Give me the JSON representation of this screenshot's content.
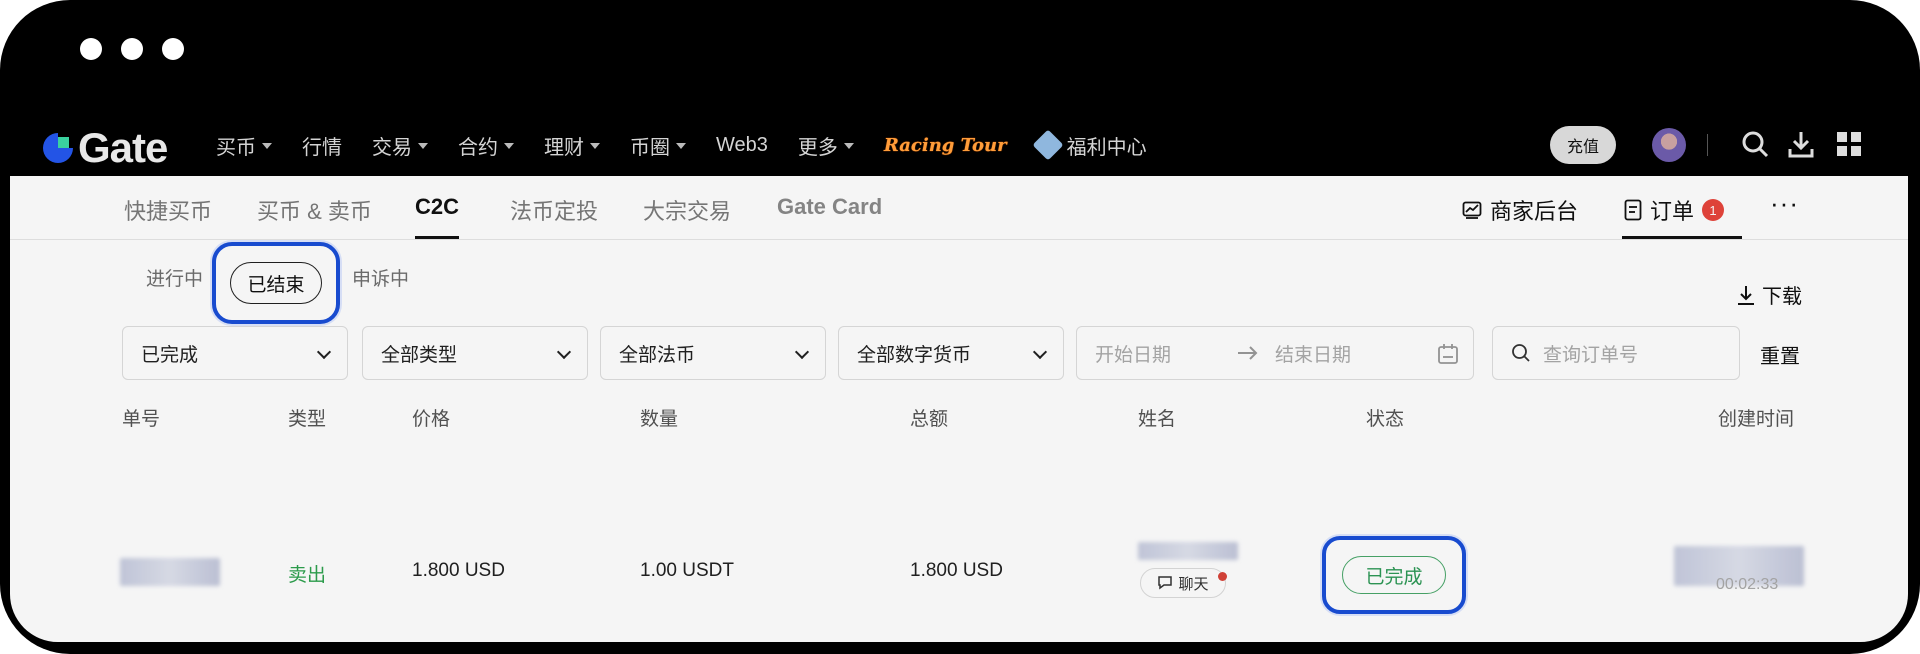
{
  "colors": {
    "accent": "#1a4fd8",
    "success": "#2e9a57",
    "badge": "#e8453c"
  },
  "brand": {
    "name": "Gate"
  },
  "topnav": {
    "items": [
      {
        "label": "买币",
        "dropdown": true
      },
      {
        "label": "行情",
        "dropdown": false
      },
      {
        "label": "交易",
        "dropdown": true
      },
      {
        "label": "合约",
        "dropdown": true
      },
      {
        "label": "理财",
        "dropdown": true
      },
      {
        "label": "币圈",
        "dropdown": true
      },
      {
        "label": "Web3",
        "dropdown": false
      },
      {
        "label": "更多",
        "dropdown": true
      }
    ],
    "racing_label": "Racing Tour",
    "welfare_label": "福利中心",
    "recharge_label": "充值"
  },
  "subnav": {
    "tabs": [
      "快捷买币",
      "买币 & 卖币",
      "C2C",
      "法币定投",
      "大宗交易",
      "Gate Card"
    ],
    "merchant_label": "商家后台",
    "orders_label": "订单",
    "orders_badge": "1",
    "more_label": "···"
  },
  "status_tabs": {
    "ongoing": "进行中",
    "ended": "已结束",
    "appeal": "申诉中"
  },
  "download_label": "下载",
  "filters": {
    "status": "已完成",
    "type": "全部类型",
    "fiat": "全部法币",
    "crypto": "全部数字货币",
    "start_date": "开始日期",
    "end_date": "结束日期",
    "search_placeholder": "查询订单号",
    "reset_label": "重置"
  },
  "table": {
    "headers": [
      "单号",
      "类型",
      "价格",
      "数量",
      "总额",
      "姓名",
      "状态",
      "创建时间"
    ],
    "row": {
      "type": "卖出",
      "price": "1.800 USD",
      "quantity": "1.00 USDT",
      "total": "1.800 USD",
      "chat_label": "聊天",
      "status": "已完成",
      "time_partial": "00:02:33"
    }
  }
}
